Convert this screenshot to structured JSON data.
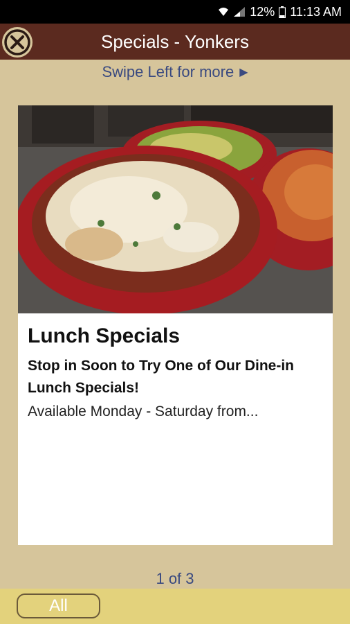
{
  "status_bar": {
    "battery_percent": "12%",
    "time": "11:13 AM",
    "icons": [
      "wifi-icon",
      "signal-icon",
      "battery-icon"
    ]
  },
  "header": {
    "title": "Specials - Yonkers",
    "close_icon": "close-circle-icon"
  },
  "swipe_hint": {
    "text": "Swipe Left for more",
    "arrow_icon": "play-arrow-icon"
  },
  "special": {
    "title": "Lunch Specials",
    "subtitle": "Stop in Soon to Try One of Our Dine-in Lunch Specials!",
    "description": "Available Monday - Saturday from..."
  },
  "pager": {
    "text": "1 of 3"
  },
  "bottom_bar": {
    "all_label": "All"
  },
  "colors": {
    "background": "#d6c59b",
    "header": "#5b2a1f",
    "accent_text": "#3a4a80",
    "bottom_bar": "#e3d27c"
  }
}
